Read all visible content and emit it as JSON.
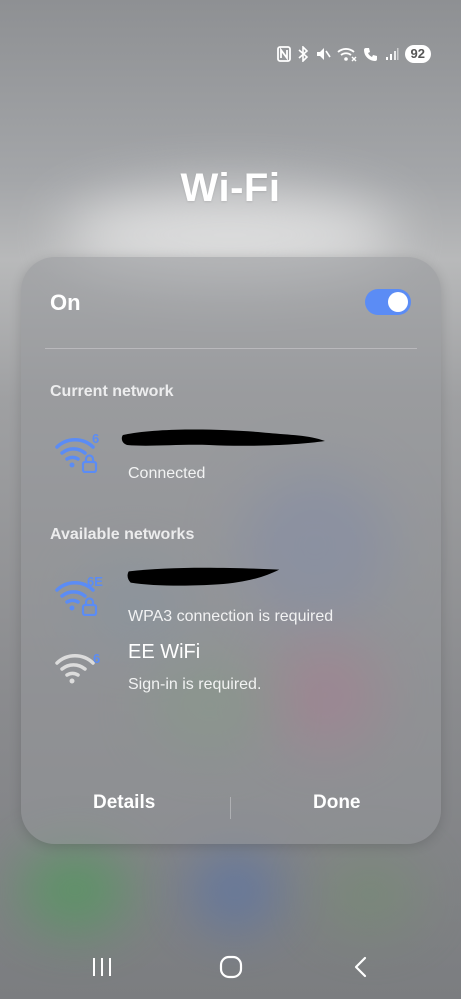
{
  "status_bar": {
    "icons": [
      "nfc-icon",
      "bluetooth-icon",
      "mute-icon",
      "wifi-calling-icon",
      "vowifi-call-icon",
      "signal-icon"
    ],
    "battery": "92"
  },
  "title": "Wi-Fi",
  "wifi_toggle": {
    "label": "On",
    "state": "on"
  },
  "current_network": {
    "header": "Current network",
    "ssid": "",
    "status": "Connected",
    "badge": "6",
    "color": "#5b8cf5"
  },
  "available_networks": {
    "header": "Available networks",
    "items": [
      {
        "ssid": "",
        "status": "WPA3 connection is required",
        "badge": "6E",
        "locked": true,
        "color": "#5b8cf5"
      },
      {
        "ssid": "EE WiFi",
        "status": "Sign-in is required.",
        "badge": "6",
        "locked": false,
        "color": "#dcdcdc"
      }
    ]
  },
  "actions": {
    "details": "Details",
    "done": "Done"
  },
  "nav": [
    "recents-button",
    "home-button",
    "back-button"
  ],
  "colors": {
    "accent": "#5b8cf5",
    "panel": "#96989b"
  }
}
